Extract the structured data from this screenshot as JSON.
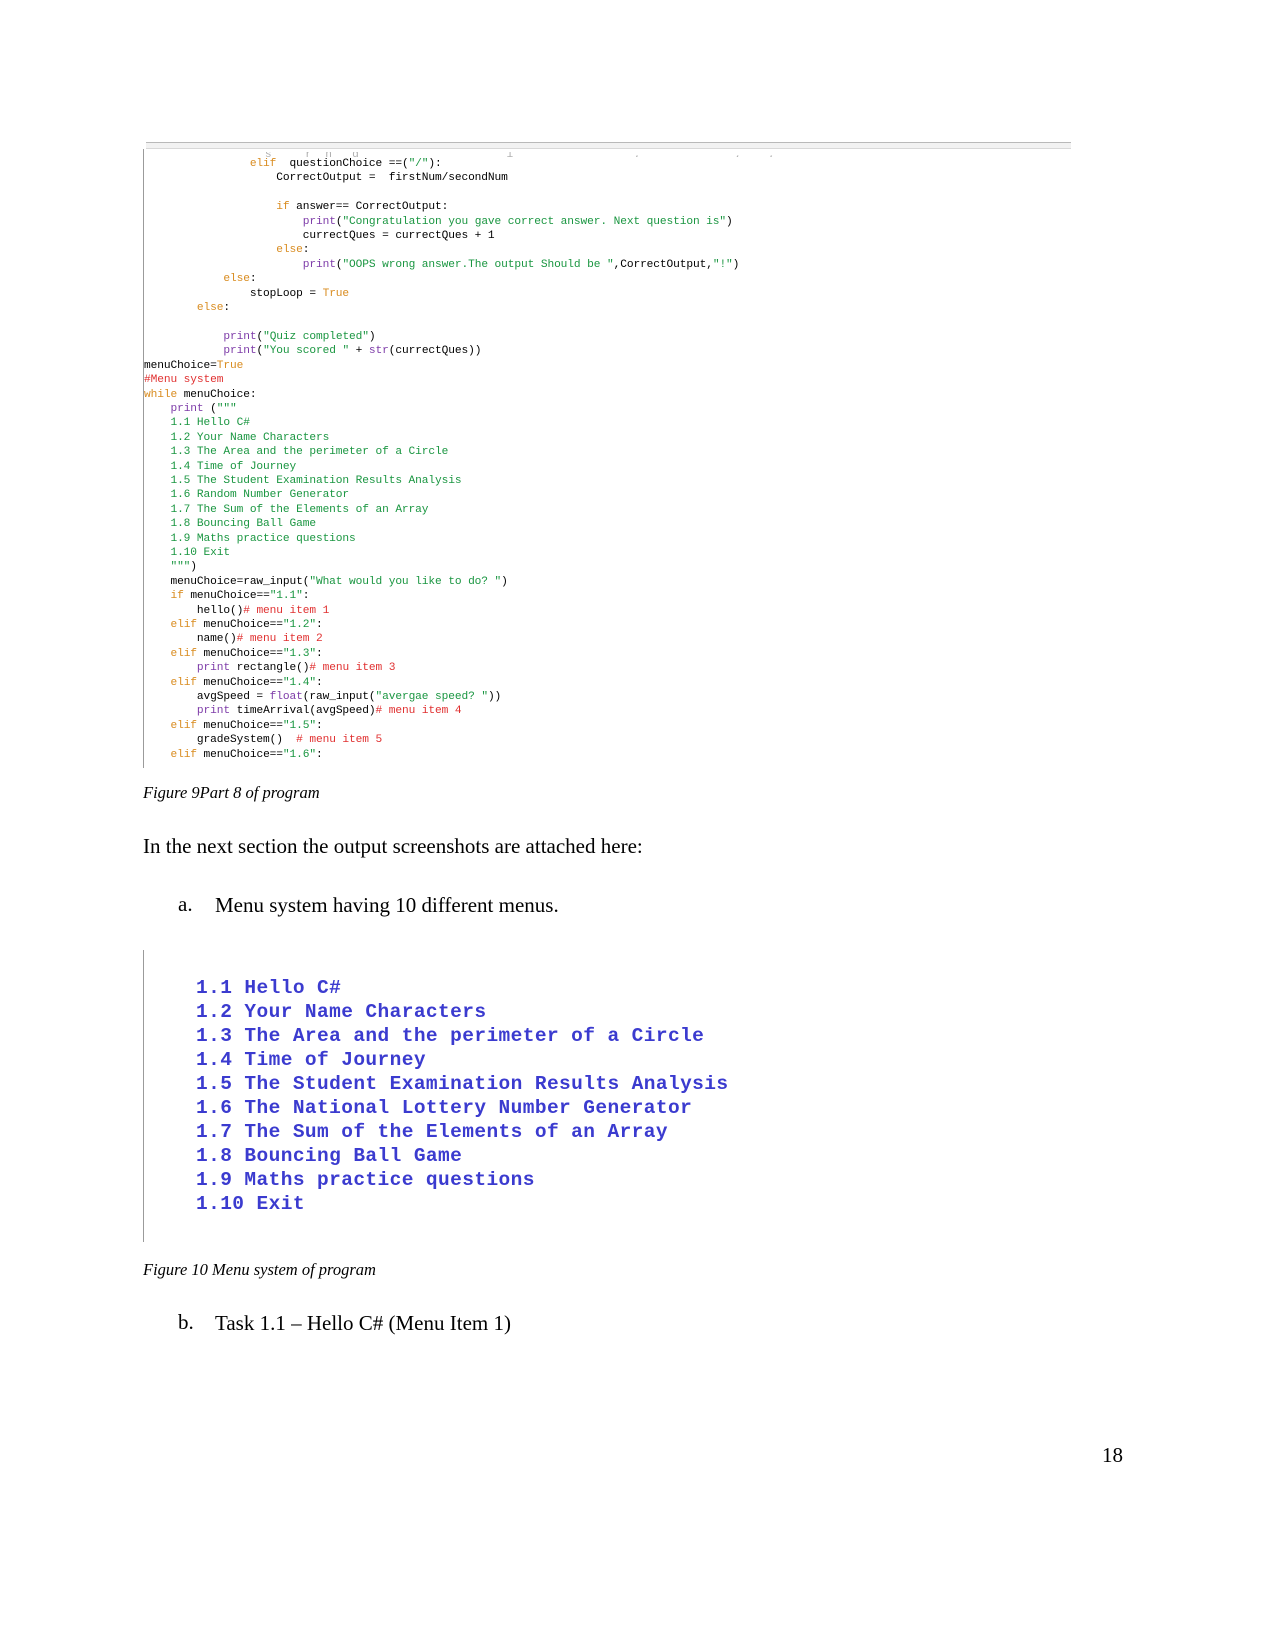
{
  "document": {
    "page_number": "18"
  },
  "figure9": {
    "caption": "Figure 9Part 8 of program",
    "cropped_top_line": "                  s     r  n   g                      i                  ,              ,    ,",
    "code_lines": [
      {
        "id": "l1",
        "text": "                elif  questionChoice ==(\"/\"):"
      },
      {
        "id": "l2",
        "text": "                    CorrectOutput =  firstNum/secondNum"
      },
      {
        "id": "l3",
        "text": ""
      },
      {
        "id": "l4",
        "text": "                    if answer== CorrectOutput:"
      },
      {
        "id": "l5",
        "text": "                        print(\"Congratulation you gave correct answer. Next question is\")"
      },
      {
        "id": "l6",
        "text": "                        currectQues = currectQues + 1"
      },
      {
        "id": "l7",
        "text": "                    else:"
      },
      {
        "id": "l8",
        "text": "                        print(\"OOPS wrong answer.The output Should be \",CorrectOutput,\"!\")"
      },
      {
        "id": "l9",
        "text": "            else:"
      },
      {
        "id": "l10",
        "text": "                stopLoop = True"
      },
      {
        "id": "l11",
        "text": "        else:"
      },
      {
        "id": "l12",
        "text": ""
      },
      {
        "id": "l13",
        "text": "            print(\"Quiz completed\")"
      },
      {
        "id": "l14",
        "text": "            print(\"You scored \" + str(currectQues))"
      },
      {
        "id": "l15",
        "text": "menuChoice=True"
      },
      {
        "id": "l16",
        "text": "#Menu system"
      },
      {
        "id": "l17",
        "text": "while menuChoice:"
      },
      {
        "id": "l18",
        "text": "    print (\"\"\""
      },
      {
        "id": "l19",
        "text": "    1.1 Hello C#"
      },
      {
        "id": "l20",
        "text": "    1.2 Your Name Characters"
      },
      {
        "id": "l21",
        "text": "    1.3 The Area and the perimeter of a Circle"
      },
      {
        "id": "l22",
        "text": "    1.4 Time of Journey"
      },
      {
        "id": "l23",
        "text": "    1.5 The Student Examination Results Analysis"
      },
      {
        "id": "l24",
        "text": "    1.6 Random Number Generator"
      },
      {
        "id": "l25",
        "text": "    1.7 The Sum of the Elements of an Array"
      },
      {
        "id": "l26",
        "text": "    1.8 Bouncing Ball Game"
      },
      {
        "id": "l27",
        "text": "    1.9 Maths practice questions"
      },
      {
        "id": "l28",
        "text": "    1.10 Exit"
      },
      {
        "id": "l29",
        "text": "    \"\"\")"
      },
      {
        "id": "l30",
        "text": "    menuChoice=raw_input(\"What would you like to do? \")"
      },
      {
        "id": "l31",
        "text": "    if menuChoice==\"1.1\":"
      },
      {
        "id": "l32",
        "text": "        hello()# menu item 1"
      },
      {
        "id": "l33",
        "text": "    elif menuChoice==\"1.2\":"
      },
      {
        "id": "l34",
        "text": "        name()# menu item 2"
      },
      {
        "id": "l35",
        "text": "    elif menuChoice==\"1.3\":"
      },
      {
        "id": "l36",
        "text": "        print rectangle()# menu item 3"
      },
      {
        "id": "l37",
        "text": "    elif menuChoice==\"1.4\":"
      },
      {
        "id": "l38",
        "text": "        avgSpeed = float(raw_input(\"avergae speed? \"))"
      },
      {
        "id": "l39",
        "text": "        print timeArrival(avgSpeed)# menu item 4"
      },
      {
        "id": "l40",
        "text": "    elif menuChoice==\"1.5\":"
      },
      {
        "id": "l41",
        "text": "        gradeSystem()  # menu item 5"
      },
      {
        "id": "l42",
        "text": "    elif menuChoice==\"1.6\":"
      }
    ]
  },
  "body": {
    "intro_paragraph": "In the next section the output screenshots are attached here:",
    "item_a_marker": "a.",
    "item_a_text": "Menu system having 10 different menus.",
    "item_b_marker": "b.",
    "item_b_text": "Task 1.1 – Hello C# (Menu Item 1)"
  },
  "figure10": {
    "caption": "Figure 10 Menu system of program",
    "accent_color": "#3b3bcf",
    "menu_items": [
      "1.1 Hello C#",
      "1.2 Your Name Characters",
      "1.3 The Area and the perimeter of a Circle",
      "1.4 Time of Journey",
      "1.5 The Student Examination Results Analysis",
      "1.6 The National Lottery Number Generator",
      "1.7 The Sum of the Elements of an Array",
      "1.8 Bouncing Ball Game",
      "1.9 Maths practice questions",
      "1.10 Exit"
    ]
  }
}
